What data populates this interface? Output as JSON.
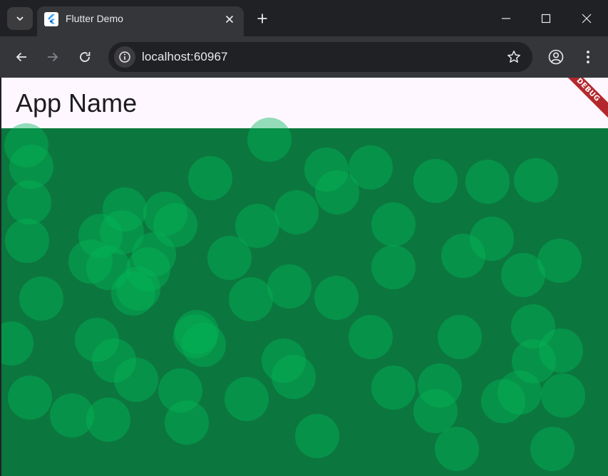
{
  "browser": {
    "tab": {
      "title": "Flutter Demo",
      "favicon": "flutter-logo-icon"
    },
    "address_bar": {
      "url": "localhost:60967"
    },
    "icons": {
      "tab_search": "chevron-down-icon",
      "tab_close": "close-icon",
      "new_tab": "plus-icon",
      "minimize": "minimize-icon",
      "maximize": "maximize-icon",
      "window_close": "close-icon",
      "back": "arrow-left-icon",
      "forward": "arrow-right-icon",
      "reload": "reload-icon",
      "site_info": "info-icon",
      "bookmark": "star-icon",
      "profile": "profile-icon",
      "menu": "kebab-menu-icon"
    }
  },
  "app": {
    "title": "App Name",
    "debug_banner": "DEBUG",
    "colors": {
      "appbar_background": "#fef7ff",
      "canvas_background": "#0b773e",
      "bubble": "#02b758",
      "debug_banner": "#b3282d"
    },
    "bubble_count": 61
  }
}
